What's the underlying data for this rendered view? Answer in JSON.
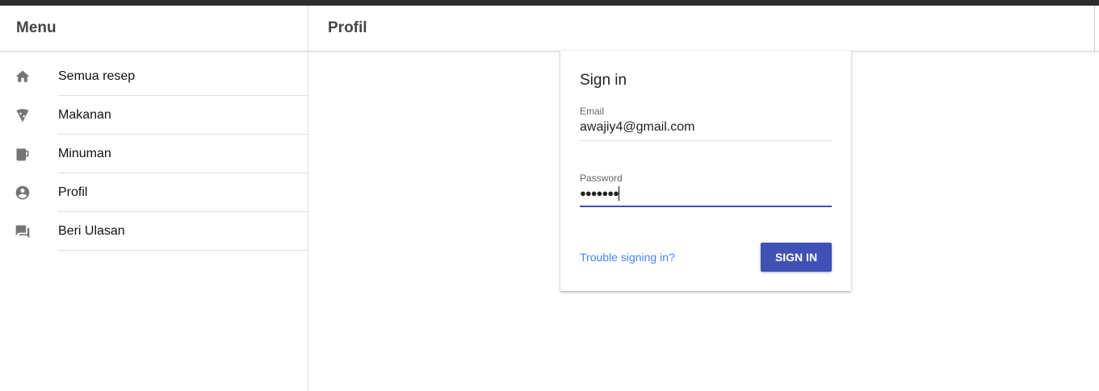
{
  "sidebar": {
    "title": "Menu",
    "items": [
      {
        "label": "Semua resep",
        "icon": "home-icon"
      },
      {
        "label": "Makanan",
        "icon": "pizza-icon"
      },
      {
        "label": "Minuman",
        "icon": "beer-mug-icon"
      },
      {
        "label": "Profil",
        "icon": "account-circle-icon"
      },
      {
        "label": "Beri Ulasan",
        "icon": "chat-icon"
      }
    ]
  },
  "header": {
    "title": "Profil"
  },
  "signin": {
    "title": "Sign in",
    "email_label": "Email",
    "email_value": "awajiy4@gmail.com",
    "password_label": "Password",
    "password_value": "●●●●●●●",
    "trouble_link": "Trouble signing in?",
    "submit_label": "SIGN IN"
  },
  "colors": {
    "accent": "#3f51b5",
    "link": "#4285f4",
    "icon": "#757575"
  }
}
